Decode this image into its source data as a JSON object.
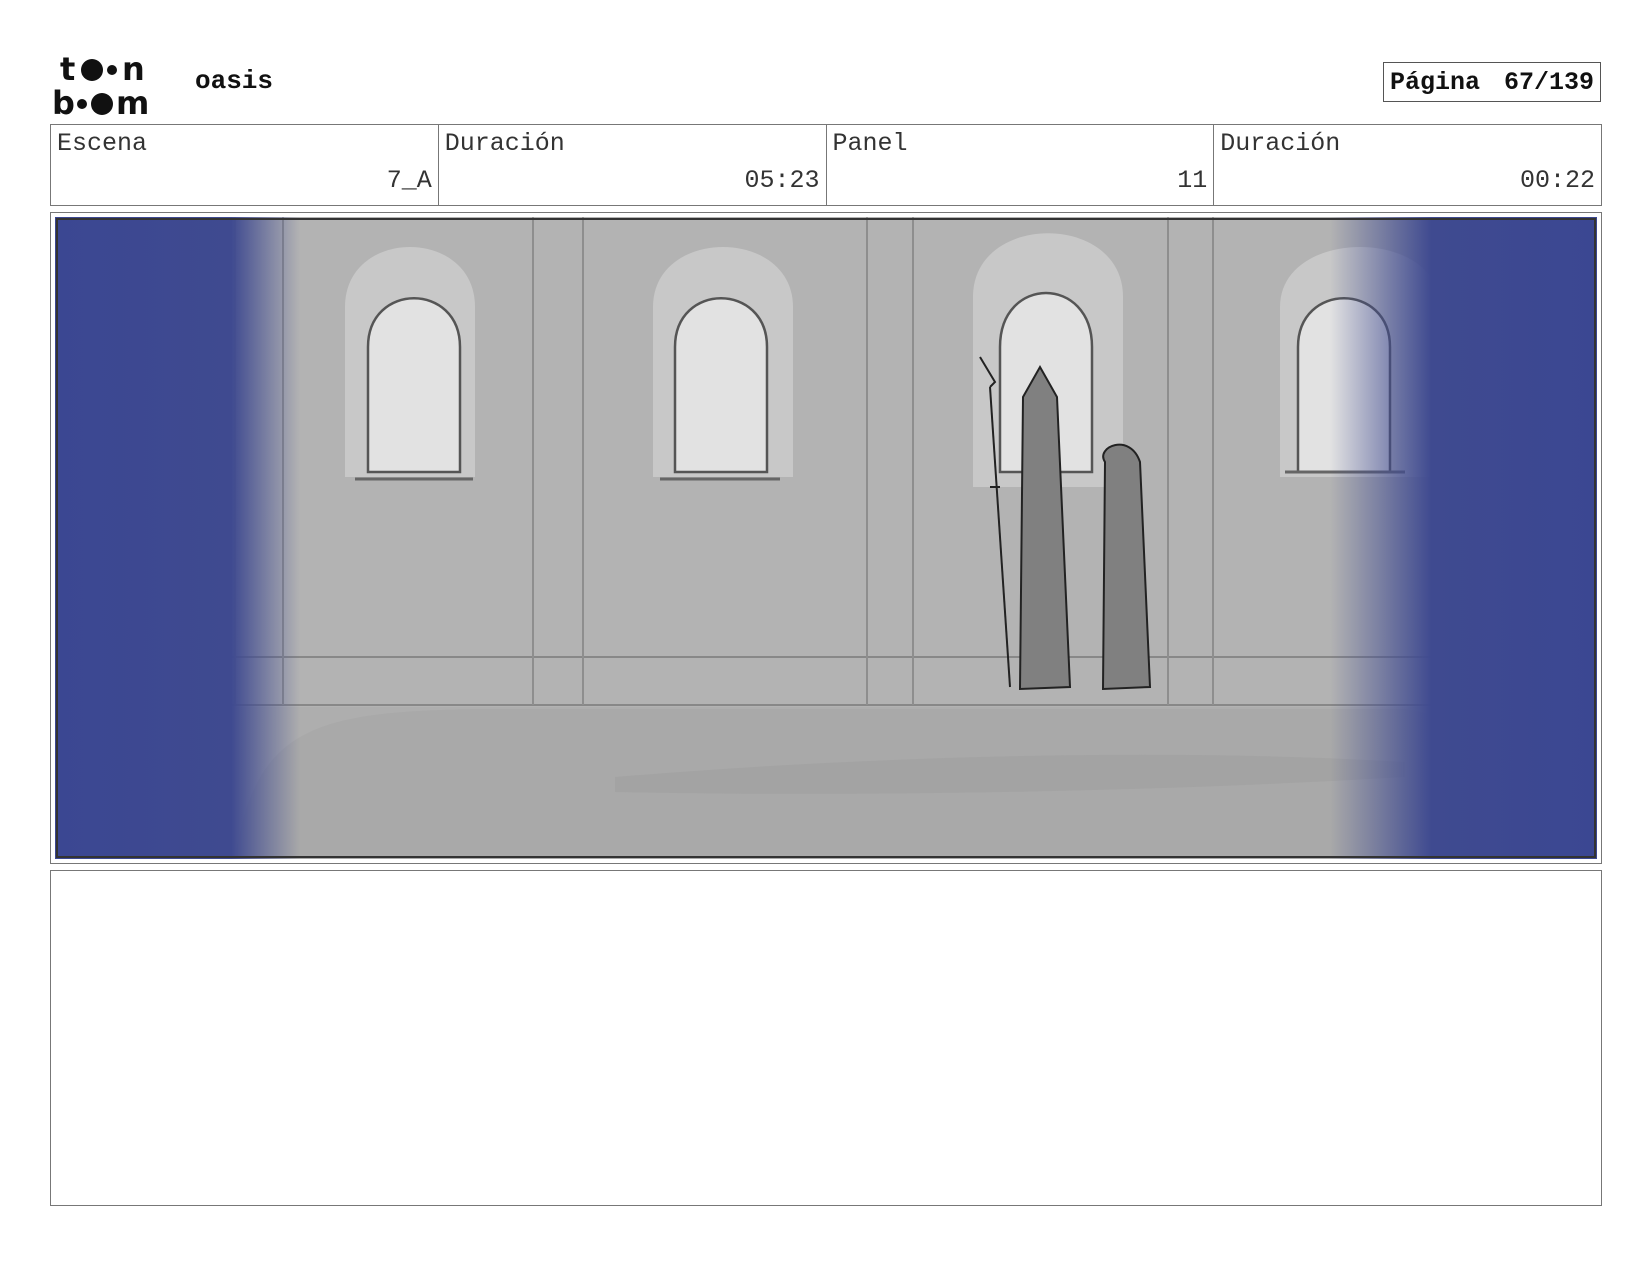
{
  "header": {
    "logo_text": "toon boom",
    "project_name": "oasis",
    "page_label": "Página",
    "page_value": "67/139"
  },
  "info": {
    "scene_label": "Escena",
    "scene_value": "7_A",
    "scene_duration_label": "Duración",
    "scene_duration_value": "05:23",
    "panel_label": "Panel",
    "panel_value": "11",
    "panel_duration_label": "Duración",
    "panel_duration_value": "00:22"
  },
  "drawing": {
    "description_colors": {
      "curtain": "#3b4792",
      "wall": "#b3b3b3",
      "window": "#e2e2e2",
      "figure": "#808080"
    }
  },
  "notes": {
    "text": ""
  }
}
